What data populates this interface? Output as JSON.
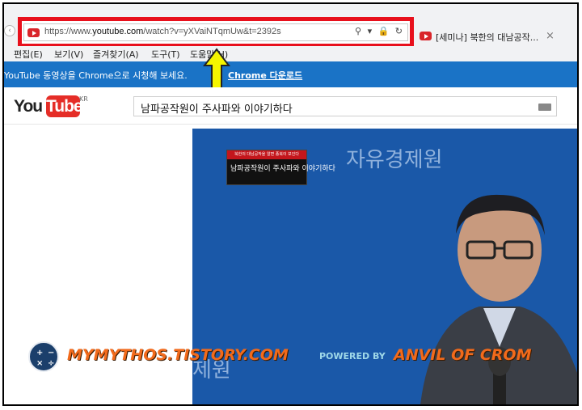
{
  "browser": {
    "url_prefix": "https://www.",
    "url_host": "youtube.com",
    "url_path": "/watch?v=yXVaiNTqmUw&t=2392s",
    "address_icons": "⚲ ▾ 🔒 ↻",
    "tab_title": "[세미나] 북한의 대남공작...",
    "tab_close": "×",
    "menu": [
      "편집(E)",
      "보기(V)",
      "즐겨찾기(A)",
      "도구(T)",
      "도움말(H)"
    ]
  },
  "promo": {
    "text": "YouTube 동영상을 Chrome으로 시청해 보세요.",
    "link": "Chrome 다운로드"
  },
  "youtube": {
    "logo_you": "You",
    "logo_tube": "Tube",
    "region": "KR",
    "search_value": "남파공작원이 주사파와 이야기하다"
  },
  "video": {
    "watermark_top": "자유경제원",
    "watermark_bottom": "제원",
    "caption_header": "북한의 대남공작을 알면 종북이 보인다",
    "caption_main": "남파공작원이 주사파와 이야기하다"
  },
  "overlay": {
    "blog": "MYMYTHOS.TISTORY.COM",
    "powered": "POWERED BY",
    "brand": "ANVIL OF CROM"
  },
  "colors": {
    "highlight_red": "#e8101c",
    "promo_blue": "#1a73c6",
    "arrow_yellow": "#f5f500",
    "overlay_orange": "#f26a1b"
  }
}
